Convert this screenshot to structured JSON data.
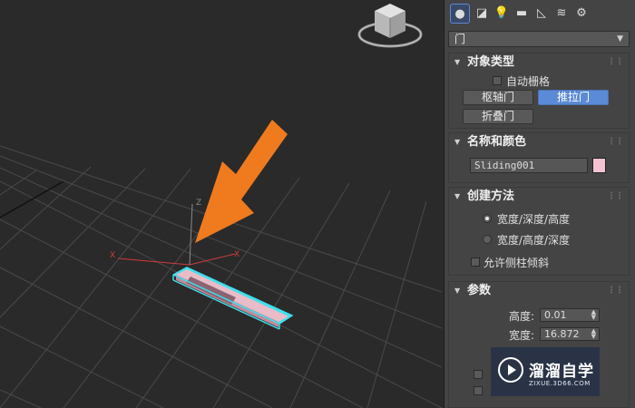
{
  "panel": {
    "tabs": [
      {
        "icon": "create-sphere-icon",
        "glyph": "●",
        "active": true
      },
      {
        "icon": "shapes-icon",
        "glyph": "◪"
      },
      {
        "icon": "lights-icon",
        "glyph": "💡"
      },
      {
        "icon": "cameras-icon",
        "glyph": "▬"
      },
      {
        "icon": "helpers-icon",
        "glyph": "◺"
      },
      {
        "icon": "spacewarps-icon",
        "glyph": "≋"
      },
      {
        "icon": "systems-icon",
        "glyph": "⚙"
      }
    ],
    "category_dropdown": "门",
    "object_type": {
      "title": "对象类型",
      "autogrid_label": "自动栅格",
      "buttons": [
        "枢轴门",
        "推拉门",
        "折叠门"
      ],
      "active_button": "推拉门"
    },
    "name_color": {
      "title": "名称和颜色",
      "name_value": "Sliding001",
      "color": "#f4c3d2"
    },
    "creation_method": {
      "title": "创建方法",
      "options": [
        "宽度/深度/高度",
        "宽度/高度/深度"
      ],
      "selected_index": 0,
      "allow_label": "允许侧柱倾斜"
    },
    "parameters": {
      "title": "参数",
      "height_label": "高度:",
      "height_value": "0.01",
      "width_label": "宽度:",
      "width_value": "16.872"
    }
  },
  "viewport": {
    "axis_x": "X",
    "axis_z": "Z",
    "arrow_color": "#f07a1e",
    "object_color": "#e9bcc8",
    "highlight_color": "#3fe0ee"
  },
  "watermark": {
    "title": "溜溜自学",
    "url": "ZIXUE.3D66.COM"
  }
}
